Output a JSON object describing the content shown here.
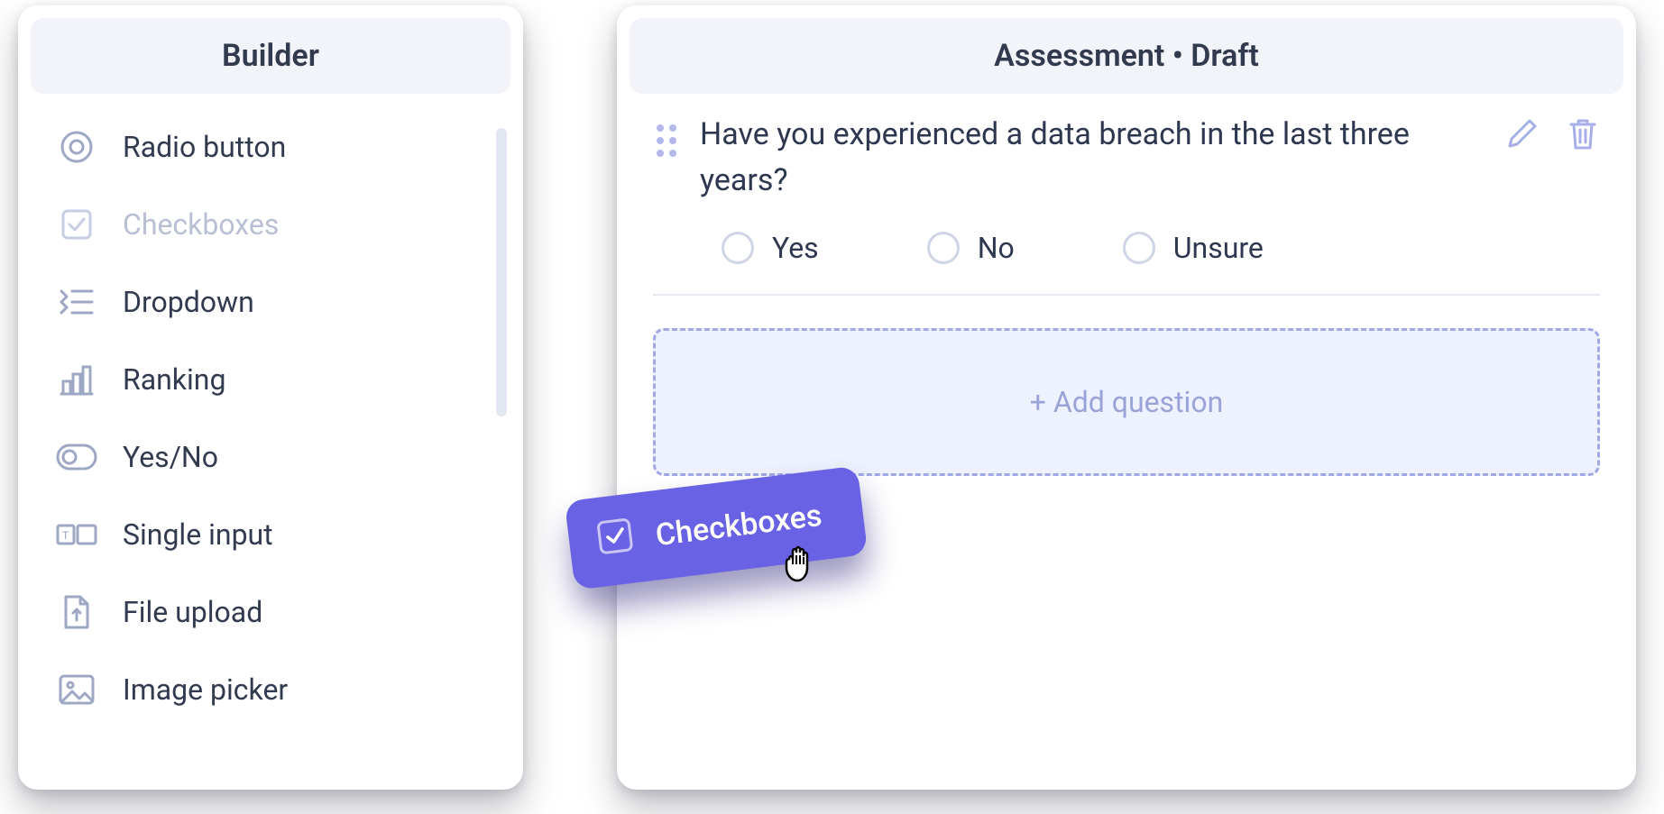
{
  "builder": {
    "title": "Builder",
    "items": [
      {
        "label": "Radio button",
        "icon": "radio-icon",
        "faded": false
      },
      {
        "label": "Checkboxes",
        "icon": "checkbox-icon",
        "faded": true
      },
      {
        "label": "Dropdown",
        "icon": "dropdown-icon",
        "faded": false
      },
      {
        "label": "Ranking",
        "icon": "ranking-icon",
        "faded": false
      },
      {
        "label": "Yes/No",
        "icon": "toggle-icon",
        "faded": false
      },
      {
        "label": "Single input",
        "icon": "single-input-icon",
        "faded": false
      },
      {
        "label": "File upload",
        "icon": "file-upload-icon",
        "faded": false
      },
      {
        "label": "Image picker",
        "icon": "image-picker-icon",
        "faded": false
      }
    ]
  },
  "canvas": {
    "header": "Assessment • Draft",
    "question": {
      "text": "Have you experienced a data breach in the last three years?",
      "options": [
        "Yes",
        "No",
        "Unsure"
      ]
    },
    "drop_zone_label": "+ Add question"
  },
  "drag_chip": {
    "label": "Checkboxes"
  },
  "colors": {
    "accent": "#6a62e4",
    "muted_icon": "#9ea8c5",
    "faded_text": "#b9c0d4",
    "panel_header_bg": "#f2f4f9",
    "drop_zone_bg": "#eef1fe",
    "drop_zone_border": "#9fa9e8"
  }
}
